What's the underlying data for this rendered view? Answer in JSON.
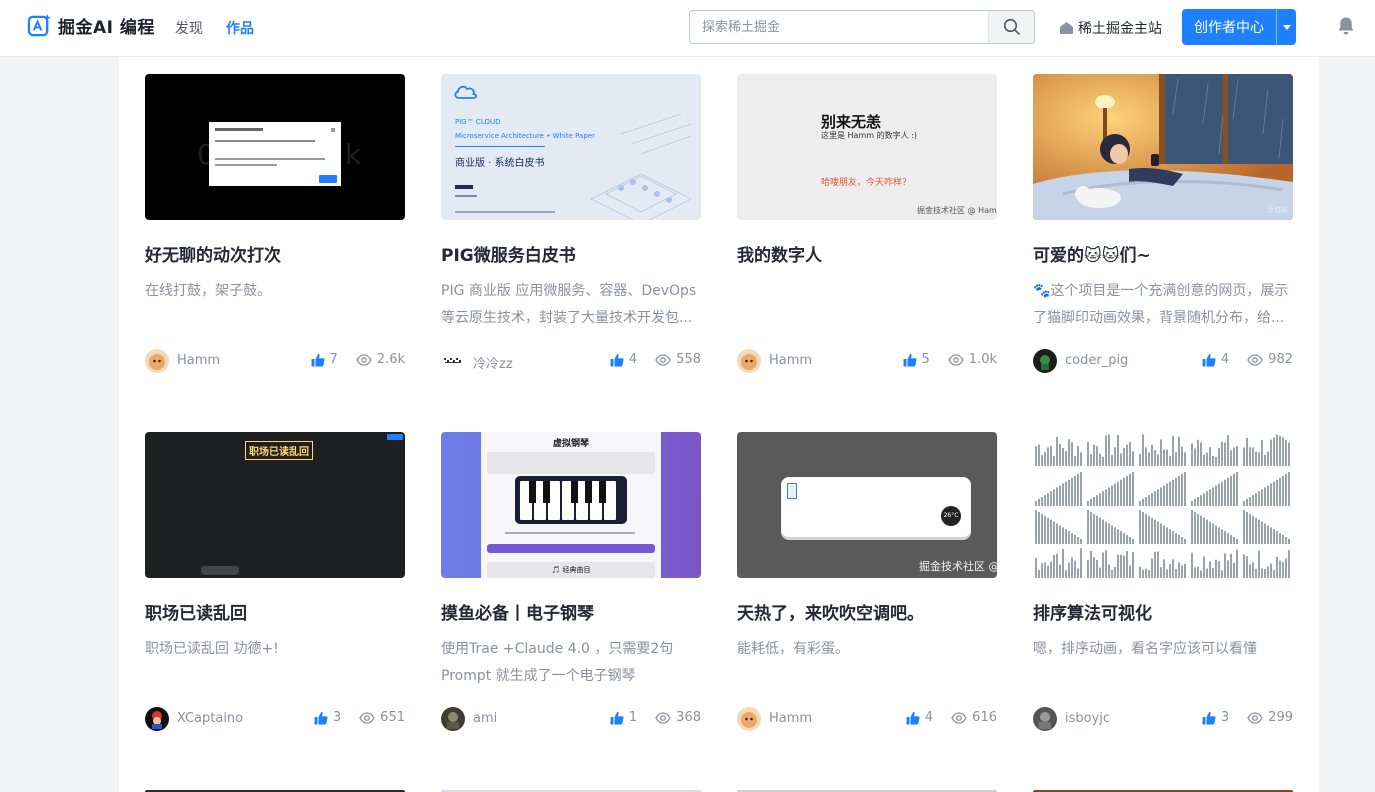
{
  "header": {
    "brand": "掘金AI 编程",
    "nav": [
      "发现",
      "作品"
    ],
    "search_placeholder": "探索稀土掘金",
    "home_link": "稀土掘金主站",
    "creator_button": "创作者中心"
  },
  "thumb_text": {
    "pig_brand": "PIG™ CLOUD",
    "pig_subtitle": "Microservice Architecture • White Paper",
    "pig_heading": "商业版 · 系统白皮书",
    "digital_heading": "别来无恙",
    "digital_sub": "这里是 Hamm 的数字人 :)",
    "digital_greeting": "哈喽朋友，今天咋样？",
    "digital_watermark": "掘金技术社区 @ Hamm",
    "cat_watermark": "豆包AI",
    "office_banner": "职场已读乱回",
    "piano_heading": "虚拟钢琴",
    "piano_button": "🎵 经典曲目",
    "ac_temp": "26°C",
    "ac_watermark": "掘金技术社区 @"
  },
  "cards": [
    {
      "title": "好无聊的动次打次",
      "desc": "在线打鼓，架子鼓。",
      "author": "Hamm",
      "likes": "7",
      "views": "2.6k"
    },
    {
      "title": "PIG微服务白皮书",
      "desc": "PIG 商业版 应用微服务、容器、DevOps 等云原生技术，封装了大量技术开发包...",
      "author": "冷冷zz",
      "likes": "4",
      "views": "558"
    },
    {
      "title": "我的数字人",
      "desc": "",
      "author": "Hamm",
      "likes": "5",
      "views": "1.0k"
    },
    {
      "title": "可爱的🐱🐱们~",
      "desc": "🐾这个项目是一个充满创意的网页，展示了猫脚印动画效果，背景随机分布，给...",
      "author": "coder_pig",
      "likes": "4",
      "views": "982"
    },
    {
      "title": "职场已读乱回",
      "desc": "职场已读乱回 功德+!",
      "author": "XCaptaino",
      "likes": "3",
      "views": "651"
    },
    {
      "title": "摸鱼必备丨电子钢琴",
      "desc": "使用Trae +Claude 4.0 ，只需要2句Prompt 就生成了一个电子钢琴",
      "author": "ami",
      "likes": "1",
      "views": "368"
    },
    {
      "title": "天热了，来吹吹空调吧。",
      "desc": "能耗低，有彩蛋。",
      "author": "Hamm",
      "likes": "4",
      "views": "616"
    },
    {
      "title": "排序算法可视化",
      "desc": "嗯，排序动画，看名字应该可以看懂",
      "author": "isboyjc",
      "likes": "3",
      "views": "299"
    }
  ],
  "colors": {
    "accent": "#1e80ff",
    "title": "#252933",
    "muted": "#8a919f"
  }
}
